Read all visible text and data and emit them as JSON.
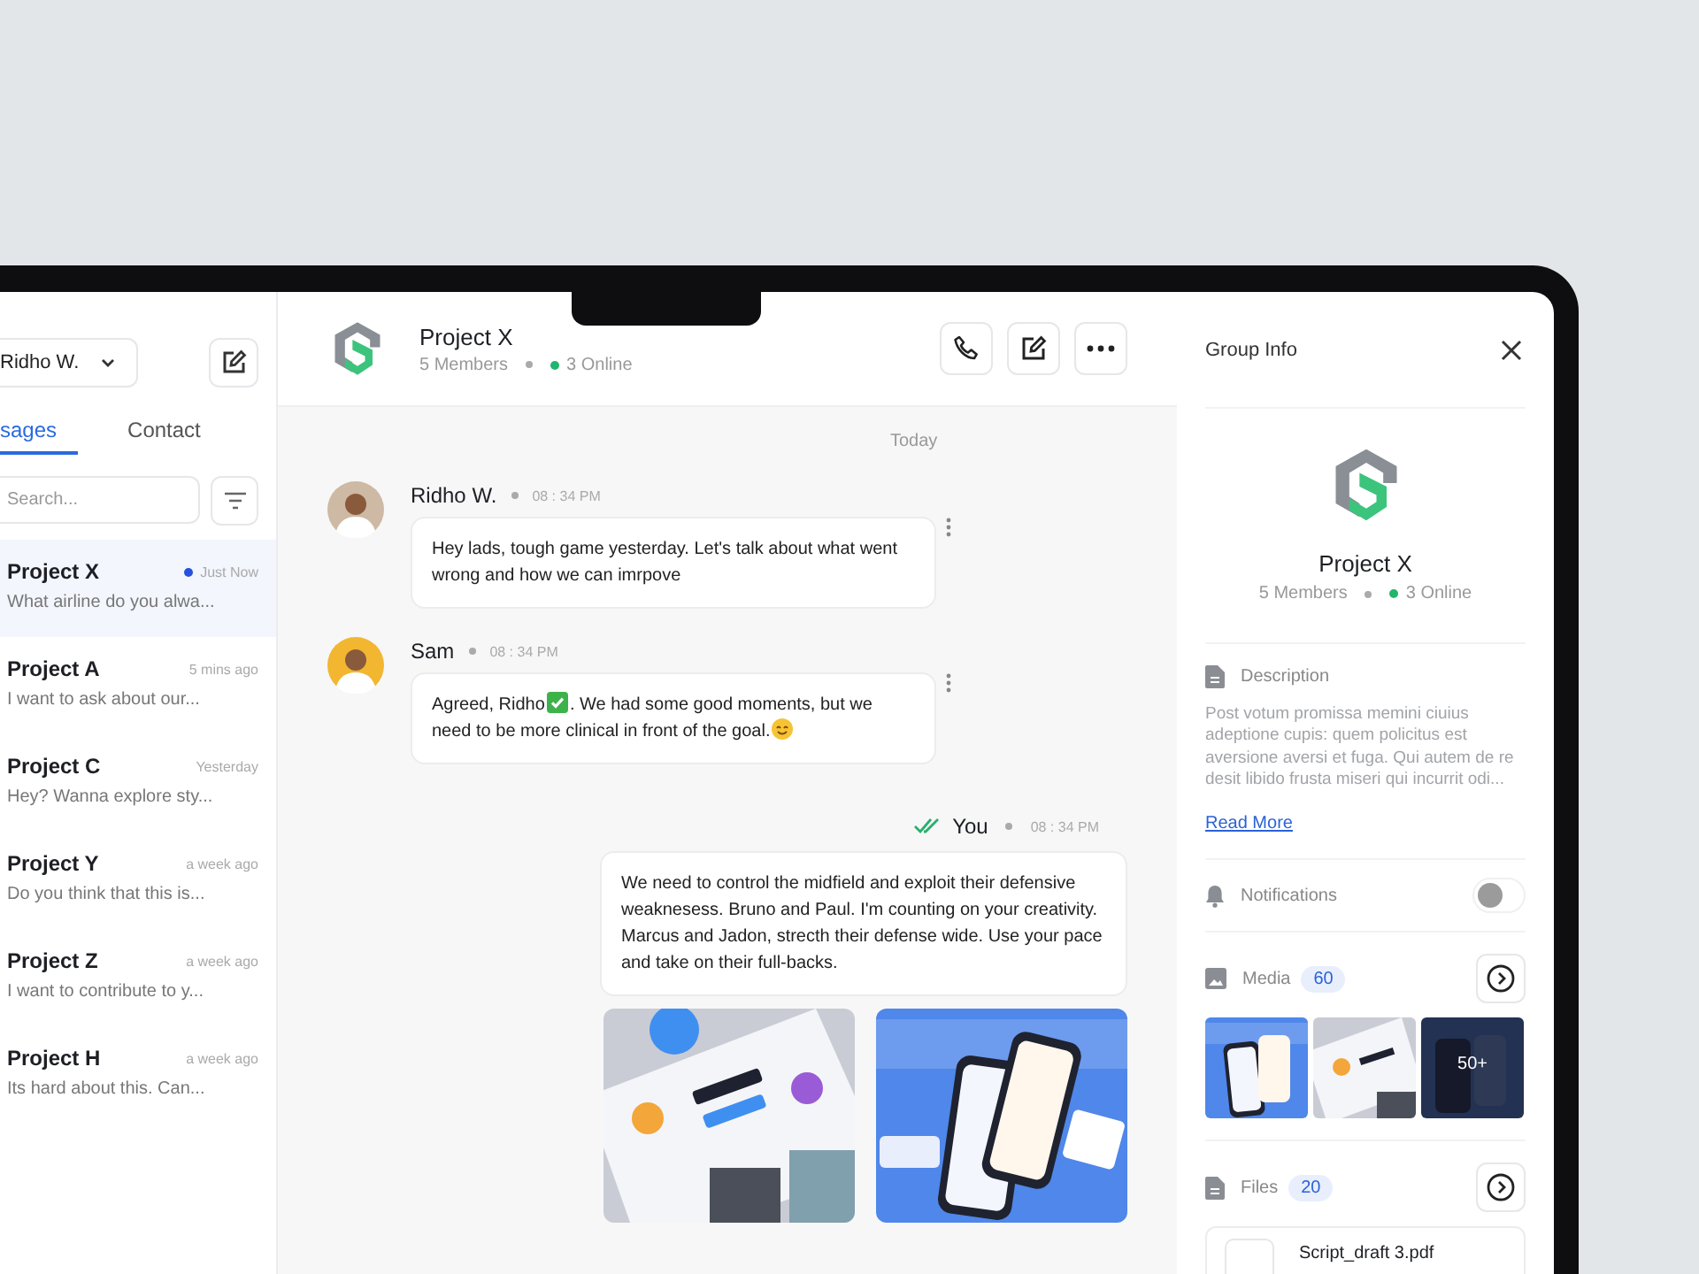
{
  "sidebar": {
    "account": "Ridho W.",
    "tabs": [
      {
        "label": "sages",
        "selected": true
      },
      {
        "label": "Contact",
        "selected": false
      }
    ],
    "search": {
      "placeholder": "Search..."
    },
    "chats": [
      {
        "name": "Project X",
        "time": "Just Now",
        "preview": "What airline do you alwa...",
        "unread": true,
        "selected": true
      },
      {
        "name": "Project A",
        "time": "5 mins ago",
        "preview": "I want to ask about our...",
        "unread": false,
        "selected": false
      },
      {
        "name": "Project C",
        "time": "Yesterday",
        "preview": "Hey? Wanna explore sty...",
        "unread": false,
        "selected": false
      },
      {
        "name": "Project Y",
        "time": "a week ago",
        "preview": "Do you think that this is...",
        "unread": false,
        "selected": false
      },
      {
        "name": "Project Z",
        "time": "a week ago",
        "preview": "I want to contribute to y...",
        "unread": false,
        "selected": false
      },
      {
        "name": "Project H",
        "time": "a week ago",
        "preview": "Its hard about this. Can...",
        "unread": false,
        "selected": false
      }
    ]
  },
  "chat": {
    "title": "Project X",
    "members": "5 Members",
    "online": "3 Online",
    "day": "Today",
    "messages": [
      {
        "kind": "incoming",
        "author": "Ridho W.",
        "time": "08 : 34 PM",
        "parts": [
          {
            "kind": "text",
            "text": "Hey lads, tough game yesterday. Let's talk about what went wrong and how we can imrpove"
          }
        ]
      },
      {
        "kind": "incoming",
        "author": "Sam",
        "time": "08 : 34 PM",
        "parts": [
          {
            "kind": "text",
            "text": "Agreed, Ridho"
          },
          {
            "kind": "check"
          },
          {
            "kind": "text",
            "text": ". We had some good moments, but we"
          },
          {
            "kind": "text",
            "text": "need to be more clinical in front of the goal."
          },
          {
            "kind": "smile"
          }
        ]
      },
      {
        "kind": "outgoing",
        "author": "You",
        "time": "08 : 34 PM",
        "read": true,
        "parts": [
          {
            "kind": "text",
            "text": "We need to control the midfield and exploit their defensive weaknesess. Bruno and Paul. I'm counting on your creativity. Marcus and Jadon, strecth their defense wide. Use your pace and take on their full-backs."
          }
        ],
        "images": [
          {
            "kind": "picture"
          },
          {
            "kind": "picture"
          }
        ]
      }
    ]
  },
  "group_info": {
    "title": "Group Info",
    "name": "Project X",
    "members": "5 Members",
    "online": "3 Online",
    "description_label": "Description",
    "description": "Post votum promissa memini ciuius adeptione cupis: quem policitus est aversione aversi et fuga. Qui autem de re desit libido frusta miseri qui incurrit odi...",
    "read_more": "Read More",
    "notifications": {
      "label": "Notifications",
      "on": false
    },
    "media": {
      "label": "Media",
      "count": "60",
      "more": "50+"
    },
    "files": {
      "label": "Files",
      "count": "20",
      "items": [
        {
          "name": "Script_draft 3.pdf"
        }
      ]
    }
  }
}
